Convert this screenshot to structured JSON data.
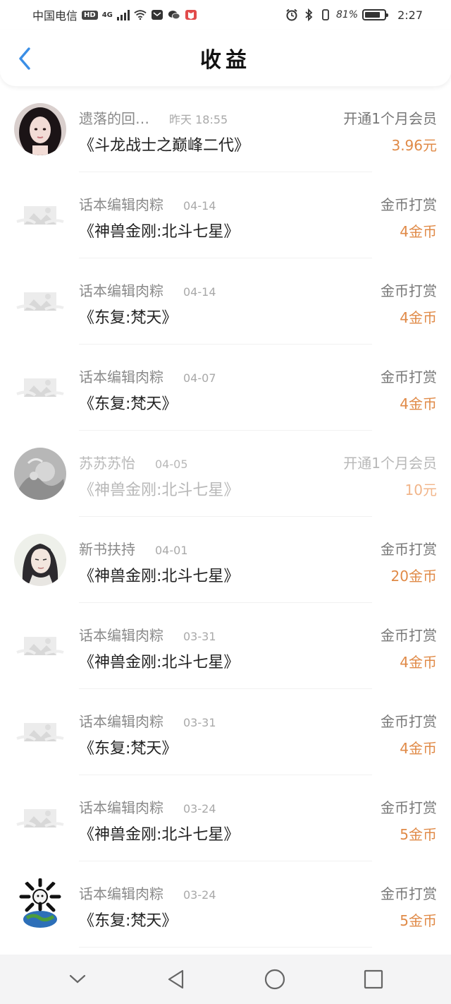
{
  "status": {
    "carrier": "中国电信",
    "hd_badge": "HD",
    "network": "4G",
    "battery_pct": "81%",
    "battery_level": 0.81,
    "time": "2:27",
    "icons": [
      "signal-icon",
      "wifi-icon",
      "message-icon",
      "wechat-icon",
      "book-app-icon",
      "alarm-icon",
      "bluetooth-icon",
      "vibrate-icon",
      "battery-icon"
    ]
  },
  "header": {
    "title": "收益",
    "back_icon": "chevron-left-icon"
  },
  "colors": {
    "accent": "#3a8ee6",
    "amount": "#e08a47",
    "name": "#8a8a8a",
    "divider": "#f1f1f1"
  },
  "items": [
    {
      "name": "遗落的回…",
      "date": "昨天 18:55",
      "type": "开通1个月会员",
      "book": "《斗龙战士之巅峰二代》",
      "amount": "3.96元",
      "avatar": "girl-photo",
      "faded": false
    },
    {
      "name": "话本编辑肉粽",
      "date": "04-14",
      "type": "金币打赏",
      "book": "《神兽金刚:北斗七星》",
      "amount": "4金币",
      "avatar": "placeholder",
      "faded": false
    },
    {
      "name": "话本编辑肉粽",
      "date": "04-14",
      "type": "金币打赏",
      "book": "《东复:梵天》",
      "amount": "4金币",
      "avatar": "placeholder",
      "faded": false
    },
    {
      "name": "话本编辑肉粽",
      "date": "04-07",
      "type": "金币打赏",
      "book": "《东复:梵天》",
      "amount": "4金币",
      "avatar": "placeholder",
      "faded": false
    },
    {
      "name": "苏苏苏怡",
      "date": "04-05",
      "type": "开通1个月会员",
      "book": "《神兽金刚:北斗七星》",
      "amount": "10元",
      "avatar": "sketch",
      "faded": true
    },
    {
      "name": "新书扶持",
      "date": "04-01",
      "type": "金币打赏",
      "book": "《神兽金刚:北斗七星》",
      "amount": "20金币",
      "avatar": "anime",
      "faded": false
    },
    {
      "name": "话本编辑肉粽",
      "date": "03-31",
      "type": "金币打赏",
      "book": "《神兽金刚:北斗七星》",
      "amount": "4金币",
      "avatar": "placeholder",
      "faded": false
    },
    {
      "name": "话本编辑肉粽",
      "date": "03-31",
      "type": "金币打赏",
      "book": "《东复:梵天》",
      "amount": "4金币",
      "avatar": "placeholder",
      "faded": false
    },
    {
      "name": "话本编辑肉粽",
      "date": "03-24",
      "type": "金币打赏",
      "book": "《神兽金刚:北斗七星》",
      "amount": "5金币",
      "avatar": "placeholder",
      "faded": false
    },
    {
      "name": "话本编辑肉粽",
      "date": "03-24",
      "type": "金币打赏",
      "book": "《东复:梵天》",
      "amount": "5金币",
      "avatar": "globe",
      "faded": false
    }
  ],
  "navigation": {
    "buttons": [
      "collapse-icon",
      "back-triangle-icon",
      "home-circle-icon",
      "recents-square-icon"
    ]
  }
}
